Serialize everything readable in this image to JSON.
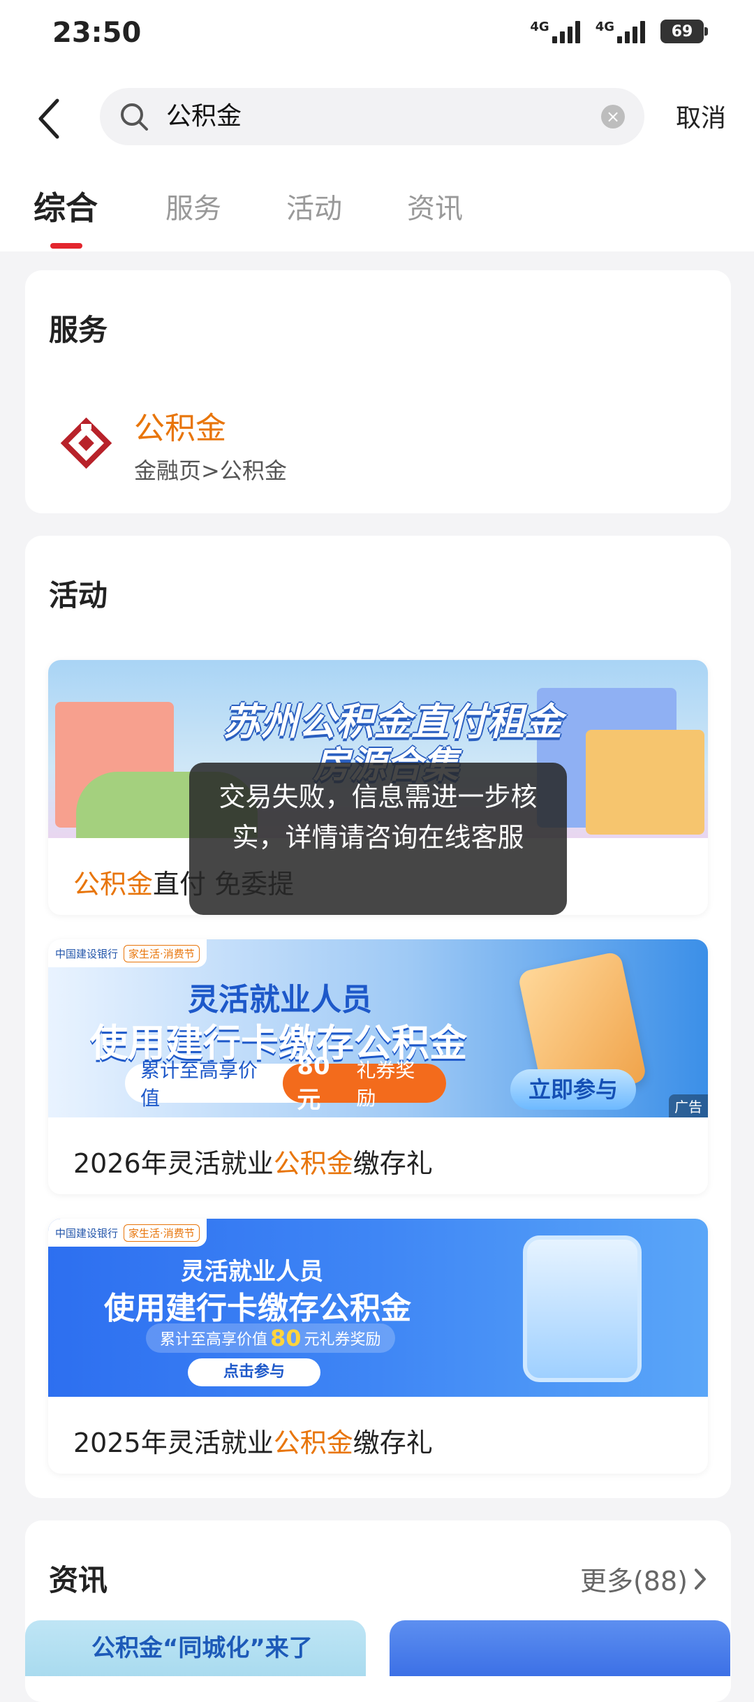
{
  "status_bar": {
    "time": "23:50",
    "network1": "4G",
    "network2": "4G",
    "battery": "69"
  },
  "search": {
    "query": "公积金",
    "cancel_label": "取消"
  },
  "tabs": [
    {
      "label": "综合",
      "active": true
    },
    {
      "label": "服务",
      "active": false
    },
    {
      "label": "活动",
      "active": false
    },
    {
      "label": "资讯",
      "active": false
    }
  ],
  "services": {
    "title": "服务",
    "item": {
      "name": "公积金",
      "path": "金融页>公积金"
    }
  },
  "activities": {
    "title": "活动",
    "items": [
      {
        "banner_title": "苏州公积金直付租金",
        "banner_subtitle": "房源合集",
        "title_hl": "公积金",
        "title_rest": "直付 免委提"
      },
      {
        "bank_name": "中国建设银行",
        "fest_tag": "家生活·消费节",
        "banner_line1": "灵活就业人员",
        "banner_line2": "使用建行卡缴存公积金",
        "pill_text": "累计至高享价值",
        "pill_amount": "80元",
        "pill_suffix": "礼券奖励",
        "cta": "立即参与",
        "ad_label": "广告",
        "title_pre": "2026年灵活就业",
        "title_hl": "公积金",
        "title_post": "缴存礼"
      },
      {
        "bank_name": "中国建设银行",
        "fest_tag": "家生活·消费节",
        "banner_line1": "灵活就业人员",
        "banner_line2": "使用建行卡缴存公积金",
        "pill_text": "累计至高享价值",
        "pill_amount": "80",
        "pill_suffix": "元礼券奖励",
        "cta": "点击参与",
        "title_pre": "2025年灵活就业",
        "title_hl": "公积金",
        "title_post": "缴存礼"
      }
    ]
  },
  "news": {
    "title": "资讯",
    "more_label": "更多(88)",
    "thumb1_text": "公积金“同城化”来了"
  },
  "toast": {
    "message": "交易失败，信息需进一步核实，详情请咨询在线客服"
  },
  "colors": {
    "accent": "#e3262e",
    "highlight": "#e8750a"
  }
}
